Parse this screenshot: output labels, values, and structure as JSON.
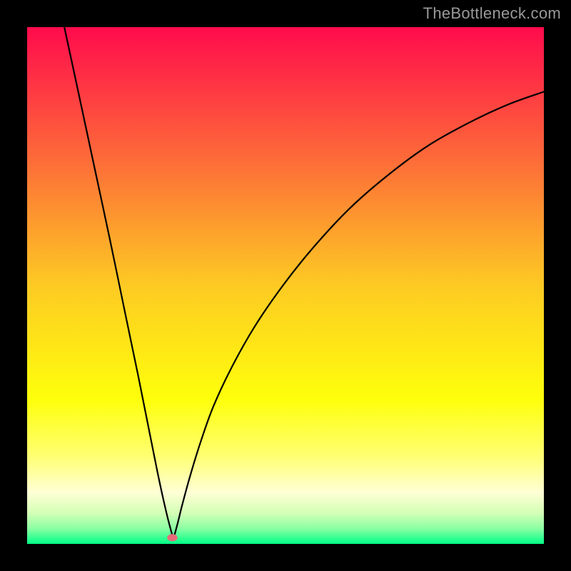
{
  "watermark": "TheBottleneck.com",
  "chart_data": {
    "type": "line",
    "title": "",
    "xlabel": "",
    "ylabel": "",
    "xlim": [
      0,
      1
    ],
    "ylim": [
      0,
      1
    ],
    "grid": false,
    "legend": false,
    "background_gradient": {
      "stops": [
        {
          "pos": 0.0,
          "color": "#ff0b4c"
        },
        {
          "pos": 0.25,
          "color": "#fd6939"
        },
        {
          "pos": 0.5,
          "color": "#fdca23"
        },
        {
          "pos": 0.72,
          "color": "#feff0b"
        },
        {
          "pos": 0.83,
          "color": "#ffff72"
        },
        {
          "pos": 0.9,
          "color": "#ffffd5"
        },
        {
          "pos": 0.94,
          "color": "#d4ffb6"
        },
        {
          "pos": 0.97,
          "color": "#8cffa3"
        },
        {
          "pos": 1.0,
          "color": "#00ff87"
        }
      ]
    },
    "series": [
      {
        "name": "bottleneck-curve",
        "note": "Two-branch V curve meeting near x≈0.28 at minimum. Values are normalized to plot area (0=left/top edge of gradient box, 1=right/bottom). y here is measured from top.",
        "points": [
          {
            "x": 0.072,
            "y": 0.0
          },
          {
            "x": 0.1,
            "y": 0.13
          },
          {
            "x": 0.13,
            "y": 0.27
          },
          {
            "x": 0.16,
            "y": 0.41
          },
          {
            "x": 0.19,
            "y": 0.555
          },
          {
            "x": 0.215,
            "y": 0.675
          },
          {
            "x": 0.235,
            "y": 0.775
          },
          {
            "x": 0.252,
            "y": 0.86
          },
          {
            "x": 0.265,
            "y": 0.92
          },
          {
            "x": 0.276,
            "y": 0.965
          },
          {
            "x": 0.283,
            "y": 0.985
          },
          {
            "x": 0.29,
            "y": 0.965
          },
          {
            "x": 0.3,
            "y": 0.925
          },
          {
            "x": 0.315,
            "y": 0.87
          },
          {
            "x": 0.335,
            "y": 0.805
          },
          {
            "x": 0.36,
            "y": 0.735
          },
          {
            "x": 0.395,
            "y": 0.66
          },
          {
            "x": 0.44,
            "y": 0.58
          },
          {
            "x": 0.495,
            "y": 0.5
          },
          {
            "x": 0.555,
            "y": 0.425
          },
          {
            "x": 0.625,
            "y": 0.35
          },
          {
            "x": 0.7,
            "y": 0.285
          },
          {
            "x": 0.775,
            "y": 0.23
          },
          {
            "x": 0.855,
            "y": 0.185
          },
          {
            "x": 0.93,
            "y": 0.15
          },
          {
            "x": 1.0,
            "y": 0.125
          }
        ]
      }
    ],
    "marker": {
      "name": "min-marker",
      "x": 0.281,
      "y": 0.988,
      "rx": 0.01,
      "ry": 0.007,
      "color": "#e76a7a"
    }
  }
}
